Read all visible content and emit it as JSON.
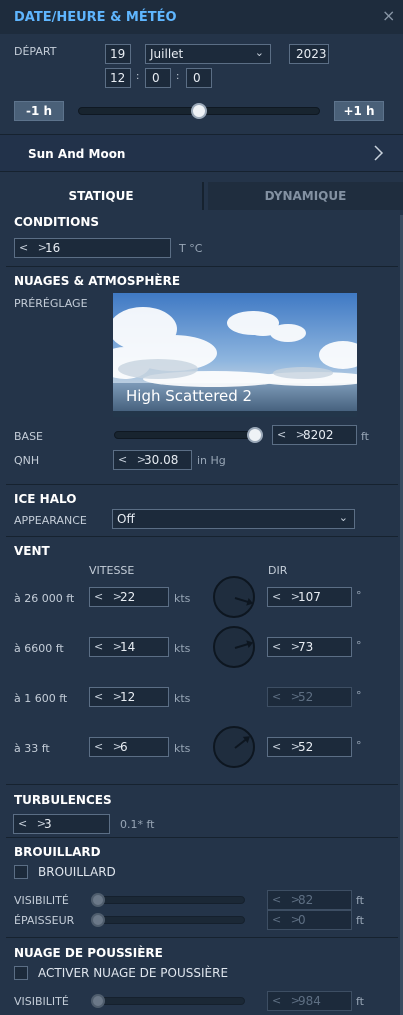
{
  "header": {
    "title": "DATE/HEURE & MÉTÉO",
    "close": "×"
  },
  "date": {
    "label": "DÉPART",
    "day": "19",
    "month": "Juillet",
    "year": "2023",
    "hour": "12",
    "minute": "0",
    "second": "0",
    "sep": ":"
  },
  "time_slider": {
    "minus": "-1 h",
    "plus": "+1 h",
    "position": 0.5
  },
  "sun_moon": {
    "label": "Sun And Moon"
  },
  "tabs": [
    {
      "label": "STATIQUE",
      "active": true
    },
    {
      "label": "DYNAMIQUE",
      "active": false
    }
  ],
  "conditions": {
    "title": "CONDITIONS",
    "temperature": "16",
    "unit": "T °C"
  },
  "clouds": {
    "title": "NUAGES & ATMOSPHÈRE",
    "preset_label": "PRÉRÉGLAGE",
    "preset_name": "High Scattered 2",
    "base_label": "BASE",
    "base_value": "8202",
    "base_unit": "ft",
    "base_position": 1.0,
    "qnh_label": "QNH",
    "qnh_value": "30.08",
    "qnh_unit": "in Hg"
  },
  "ice_halo": {
    "title": "ICE HALO",
    "appearance_label": "APPEARANCE",
    "appearance_value": "Off"
  },
  "wind": {
    "title": "VENT",
    "speed_header": "VITESSE",
    "dir_header": "DIR",
    "speed_unit": "kts",
    "dir_unit": "°",
    "rows": [
      {
        "alt": "à 26 000 ft",
        "speed": "22",
        "dir": "107",
        "disabled": false
      },
      {
        "alt": "à 6600 ft",
        "speed": "14",
        "dir": "73",
        "disabled": false
      },
      {
        "alt": "à 1 600 ft",
        "speed": "12",
        "dir": "52",
        "disabled": true
      },
      {
        "alt": "à 33 ft",
        "speed": "6",
        "dir": "52",
        "disabled": false
      }
    ]
  },
  "turbulence": {
    "title": "TURBULENCES",
    "value": "3",
    "unit": "0.1* ft"
  },
  "fog": {
    "title": "BROUILLARD",
    "checkbox": "BROUILLARD",
    "checked": false,
    "visibility_label": "VISIBILITÉ",
    "visibility_value": "82",
    "thickness_label": "ÉPAISSEUR",
    "thickness_value": "0",
    "unit": "ft"
  },
  "dust": {
    "title": "NUAGE DE POUSSIÈRE",
    "checkbox": "ACTIVER NUAGE DE POUSSIÈRE",
    "checked": false,
    "visibility_label": "VISIBILITÉ",
    "visibility_value": "984",
    "unit": "ft"
  },
  "colors": {
    "header_title": "#5fb6ff",
    "panel": "#243449",
    "header": "#1e2c3d",
    "button": "#4a6078"
  }
}
